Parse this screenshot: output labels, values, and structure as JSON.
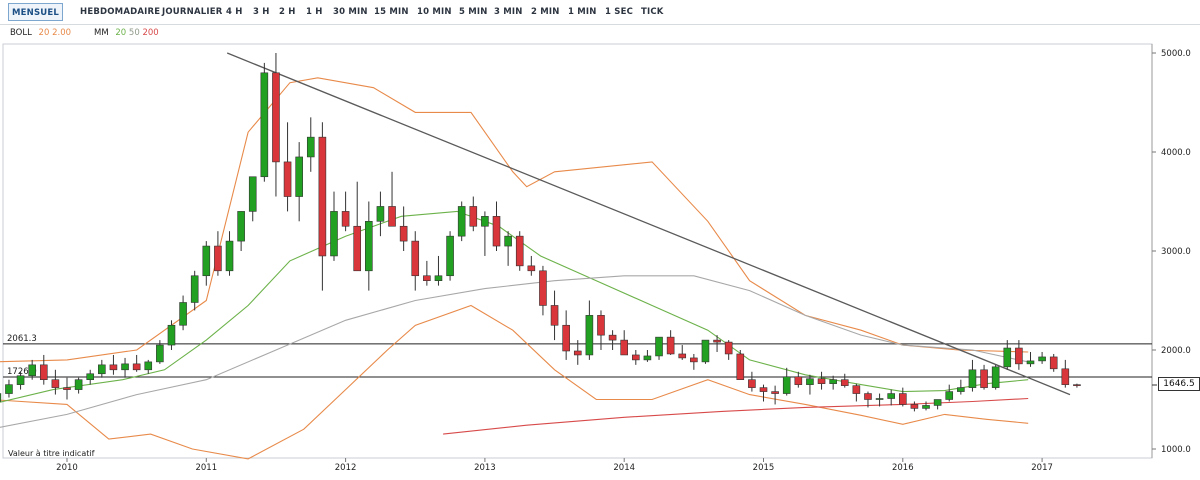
{
  "tabs": [
    {
      "label": "MENSUEL",
      "active": true
    },
    {
      "label": "HEBDOMADAIRE"
    },
    {
      "label": "JOURNALIER"
    },
    {
      "label": "4 H"
    },
    {
      "label": "3 H"
    },
    {
      "label": "2 H"
    },
    {
      "label": "1 H"
    },
    {
      "label": "30 MIN"
    },
    {
      "label": "15 MIN"
    },
    {
      "label": "10 MIN"
    },
    {
      "label": "5 MIN"
    },
    {
      "label": "3 MIN"
    },
    {
      "label": "2 MIN"
    },
    {
      "label": "1 MIN"
    },
    {
      "label": "1 SEC"
    },
    {
      "label": "TICK"
    }
  ],
  "legend": {
    "boll_label": "BOLL",
    "boll_p1": "20",
    "boll_p2": "2.00",
    "mm_label": "MM",
    "mm_p1": "20",
    "mm_p2": "50",
    "mm_p3": "200"
  },
  "colors": {
    "up": "#22a022",
    "down": "#d8363a",
    "boll": "#e88a4a",
    "mm20": "#6cb24a",
    "mm50": "#a8a8a8",
    "mm200": "#d84a4a"
  },
  "note": "Valeur à titre indicatif",
  "chart_data": {
    "type": "candlestick",
    "y_ticks": [
      "5000.0",
      "4000.0",
      "3000.0",
      "2000.0",
      "1000.0"
    ],
    "x_ticks": [
      "2010",
      "2011",
      "2012",
      "2013",
      "2014",
      "2015",
      "2016",
      "2017"
    ],
    "ylim": [
      950,
      5300
    ],
    "hlines": [
      {
        "label": "2061.3",
        "value": 2061.3
      },
      {
        "label": "1726.9",
        "value": 1726.9
      }
    ],
    "last_price": "1646.5",
    "first_month": "2009-06",
    "candles": [
      [
        1400,
        1480,
        1350,
        1480
      ],
      [
        1480,
        1600,
        1450,
        1560
      ],
      [
        1560,
        1700,
        1520,
        1650
      ],
      [
        1650,
        1780,
        1600,
        1740
      ],
      [
        1740,
        1900,
        1700,
        1850
      ],
      [
        1850,
        1950,
        1650,
        1700
      ],
      [
        1700,
        1800,
        1550,
        1620
      ],
      [
        1620,
        1720,
        1500,
        1600
      ],
      [
        1600,
        1720,
        1560,
        1700
      ],
      [
        1700,
        1800,
        1650,
        1760
      ],
      [
        1760,
        1900,
        1720,
        1850
      ],
      [
        1850,
        1950,
        1750,
        1800
      ],
      [
        1800,
        1920,
        1720,
        1860
      ],
      [
        1860,
        1950,
        1780,
        1800
      ],
      [
        1800,
        1900,
        1760,
        1880
      ],
      [
        1880,
        2100,
        1860,
        2050
      ],
      [
        2050,
        2300,
        2000,
        2250
      ],
      [
        2250,
        2550,
        2200,
        2480
      ],
      [
        2480,
        2800,
        2400,
        2750
      ],
      [
        2750,
        3100,
        2650,
        3050
      ],
      [
        3050,
        3200,
        2750,
        2800
      ],
      [
        2800,
        3200,
        2750,
        3100
      ],
      [
        3100,
        3400,
        3000,
        3400
      ],
      [
        3400,
        3750,
        3300,
        3750
      ],
      [
        3750,
        4900,
        3700,
        4800
      ],
      [
        4800,
        5000,
        3550,
        3900
      ],
      [
        3900,
        4300,
        3400,
        3550
      ],
      [
        3550,
        4100,
        3300,
        3950
      ],
      [
        3950,
        4350,
        3800,
        4150
      ],
      [
        4150,
        4300,
        2600,
        2950
      ],
      [
        2950,
        3600,
        2900,
        3400
      ],
      [
        3400,
        3600,
        3200,
        3250
      ],
      [
        3250,
        3700,
        2800,
        2800
      ],
      [
        2800,
        3500,
        2600,
        3300
      ],
      [
        3300,
        3600,
        3150,
        3450
      ],
      [
        3450,
        3800,
        3300,
        3250
      ],
      [
        3250,
        3450,
        3000,
        3100
      ],
      [
        3100,
        3200,
        2600,
        2750
      ],
      [
        2750,
        2900,
        2650,
        2700
      ],
      [
        2700,
        2950,
        2650,
        2750
      ],
      [
        2750,
        3200,
        2700,
        3150
      ],
      [
        3150,
        3500,
        3100,
        3450
      ],
      [
        3450,
        3550,
        3200,
        3250
      ],
      [
        3250,
        3400,
        2950,
        3350
      ],
      [
        3350,
        3500,
        3000,
        3050
      ],
      [
        3050,
        3200,
        2850,
        3150
      ],
      [
        3150,
        3200,
        2800,
        2850
      ],
      [
        2850,
        2950,
        2750,
        2800
      ],
      [
        2800,
        2850,
        2350,
        2450
      ],
      [
        2450,
        2600,
        2100,
        2250
      ],
      [
        2250,
        2400,
        1900,
        1990
      ],
      [
        1990,
        2100,
        1850,
        1950
      ],
      [
        1950,
        2500,
        1900,
        2350
      ],
      [
        2350,
        2400,
        2000,
        2150
      ],
      [
        2150,
        2200,
        2000,
        2100
      ],
      [
        2100,
        2200,
        1950,
        1950
      ],
      [
        1950,
        2000,
        1850,
        1900
      ],
      [
        1900,
        2000,
        1880,
        1940
      ],
      [
        1940,
        2100,
        1900,
        2130
      ],
      [
        2130,
        2200,
        1950,
        1960
      ],
      [
        1960,
        2050,
        1900,
        1920
      ],
      [
        1920,
        1960,
        1800,
        1880
      ],
      [
        1880,
        2100,
        1860,
        2100
      ],
      [
        2100,
        2150,
        1980,
        2080
      ],
      [
        2080,
        2100,
        1900,
        1960
      ],
      [
        1960,
        2000,
        1700,
        1700
      ],
      [
        1700,
        1780,
        1580,
        1620
      ],
      [
        1620,
        1650,
        1480,
        1580
      ],
      [
        1580,
        1640,
        1450,
        1560
      ],
      [
        1560,
        1820,
        1540,
        1730
      ],
      [
        1730,
        1780,
        1620,
        1650
      ],
      [
        1650,
        1750,
        1550,
        1710
      ],
      [
        1710,
        1780,
        1600,
        1660
      ],
      [
        1660,
        1740,
        1600,
        1700
      ],
      [
        1700,
        1760,
        1620,
        1640
      ],
      [
        1640,
        1660,
        1480,
        1560
      ],
      [
        1560,
        1580,
        1420,
        1500
      ],
      [
        1500,
        1560,
        1430,
        1510
      ],
      [
        1510,
        1600,
        1440,
        1560
      ],
      [
        1560,
        1620,
        1430,
        1450
      ],
      [
        1450,
        1480,
        1380,
        1410
      ],
      [
        1410,
        1480,
        1390,
        1440
      ],
      [
        1440,
        1500,
        1400,
        1500
      ],
      [
        1500,
        1650,
        1480,
        1580
      ],
      [
        1580,
        1700,
        1550,
        1620
      ],
      [
        1620,
        1900,
        1580,
        1800
      ],
      [
        1800,
        1850,
        1600,
        1620
      ],
      [
        1620,
        1850,
        1600,
        1830
      ],
      [
        1830,
        2100,
        1800,
        2020
      ],
      [
        2020,
        2100,
        1800,
        1860
      ],
      [
        1860,
        1980,
        1830,
        1890
      ],
      [
        1890,
        1980,
        1860,
        1930
      ],
      [
        1930,
        1960,
        1780,
        1810
      ],
      [
        1810,
        1900,
        1620,
        1650
      ],
      [
        1650,
        1660,
        1620,
        1646
      ]
    ],
    "series": [
      {
        "name": "BOLL 20 2.00",
        "style": "boll",
        "values": [
          [
            2009.45,
            1880
          ],
          [
            2010.0,
            1900
          ],
          [
            2010.5,
            2000
          ],
          [
            2011.0,
            2500
          ],
          [
            2011.3,
            4200
          ],
          [
            2011.6,
            4700
          ],
          [
            2011.8,
            4750
          ],
          [
            2012.2,
            4650
          ],
          [
            2012.5,
            4400
          ],
          [
            2012.9,
            4400
          ],
          [
            2013.2,
            3800
          ],
          [
            2013.3,
            3650
          ],
          [
            2013.5,
            3800
          ],
          [
            2014.2,
            3900
          ],
          [
            2014.6,
            3300
          ],
          [
            2014.9,
            2700
          ],
          [
            2015.3,
            2350
          ],
          [
            2015.7,
            2200
          ],
          [
            2016.0,
            2050
          ],
          [
            2016.4,
            2000
          ],
          [
            2016.9,
            1980
          ]
        ]
      },
      {
        "name": "BOLL 20 2.00",
        "style": "boll",
        "values": [
          [
            2009.45,
            1500
          ],
          [
            2010.0,
            1450
          ],
          [
            2010.3,
            1100
          ],
          [
            2010.6,
            1150
          ],
          [
            2010.9,
            1000
          ],
          [
            2011.3,
            900
          ],
          [
            2011.7,
            1200
          ],
          [
            2012.0,
            1600
          ],
          [
            2012.3,
            2000
          ],
          [
            2012.5,
            2250
          ],
          [
            2012.9,
            2450
          ],
          [
            2013.2,
            2200
          ],
          [
            2013.5,
            1800
          ],
          [
            2013.8,
            1500
          ],
          [
            2014.2,
            1500
          ],
          [
            2014.6,
            1700
          ],
          [
            2014.9,
            1550
          ],
          [
            2015.3,
            1450
          ],
          [
            2015.7,
            1340
          ],
          [
            2016.0,
            1250
          ],
          [
            2016.3,
            1350
          ],
          [
            2016.6,
            1300
          ],
          [
            2016.9,
            1260
          ]
        ]
      },
      {
        "name": "MM 20",
        "style": "mm20",
        "values": [
          [
            2009.45,
            1450
          ],
          [
            2009.9,
            1600
          ],
          [
            2010.4,
            1700
          ],
          [
            2010.7,
            1800
          ],
          [
            2011.0,
            2100
          ],
          [
            2011.3,
            2450
          ],
          [
            2011.6,
            2900
          ],
          [
            2012.0,
            3150
          ],
          [
            2012.4,
            3350
          ],
          [
            2012.8,
            3400
          ],
          [
            2013.1,
            3250
          ],
          [
            2013.4,
            2950
          ],
          [
            2013.8,
            2700
          ],
          [
            2014.2,
            2450
          ],
          [
            2014.6,
            2200
          ],
          [
            2014.9,
            1900
          ],
          [
            2015.3,
            1750
          ],
          [
            2015.7,
            1650
          ],
          [
            2016.0,
            1580
          ],
          [
            2016.3,
            1590
          ],
          [
            2016.6,
            1660
          ],
          [
            2016.9,
            1700
          ]
        ]
      },
      {
        "name": "MM 50",
        "style": "mm50",
        "values": [
          [
            2009.45,
            1200
          ],
          [
            2010.0,
            1350
          ],
          [
            2010.5,
            1550
          ],
          [
            2011.0,
            1700
          ],
          [
            2011.5,
            2000
          ],
          [
            2012.0,
            2300
          ],
          [
            2012.5,
            2500
          ],
          [
            2013.0,
            2620
          ],
          [
            2013.5,
            2700
          ],
          [
            2014.0,
            2750
          ],
          [
            2014.5,
            2750
          ],
          [
            2014.9,
            2600
          ],
          [
            2015.3,
            2350
          ],
          [
            2015.7,
            2150
          ],
          [
            2016.0,
            2050
          ],
          [
            2016.5,
            2000
          ],
          [
            2016.9,
            1880
          ]
        ]
      },
      {
        "name": "MM 200",
        "style": "mm200",
        "values": [
          [
            2012.7,
            1150
          ],
          [
            2013.3,
            1240
          ],
          [
            2014.0,
            1320
          ],
          [
            2014.7,
            1380
          ],
          [
            2015.3,
            1420
          ],
          [
            2016.0,
            1450
          ],
          [
            2016.5,
            1480
          ],
          [
            2016.9,
            1510
          ]
        ]
      },
      {
        "name": "trendline",
        "style": "trend",
        "values": [
          [
            2011.15,
            5000
          ],
          [
            2017.2,
            1550
          ]
        ]
      }
    ]
  }
}
